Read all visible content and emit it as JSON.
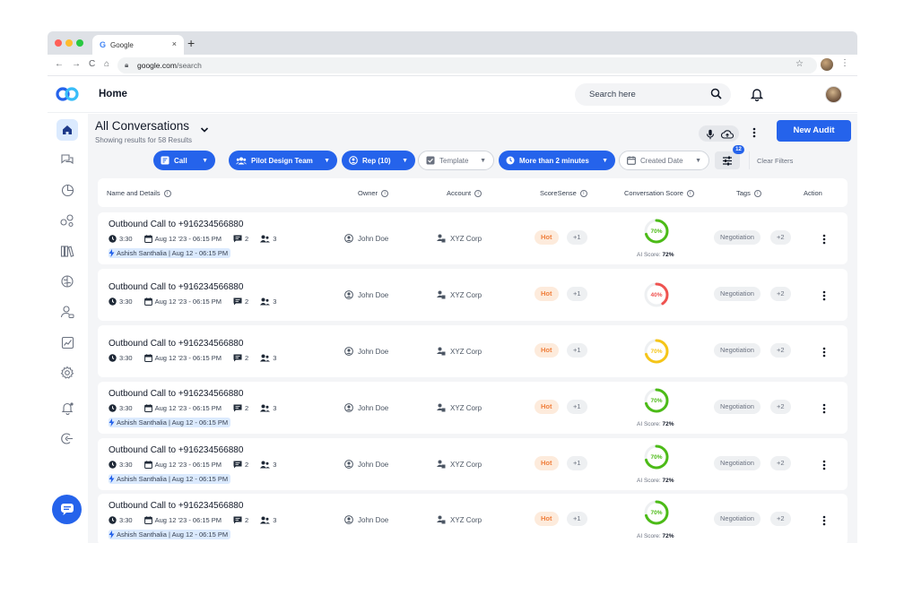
{
  "browser": {
    "tab_title": "Google",
    "tab_icon": "G",
    "tab_close": "×",
    "new_tab": "+",
    "url_host": "google.com",
    "url_path": "/search"
  },
  "header": {
    "title": "Home",
    "search_placeholder": "Search here"
  },
  "page": {
    "title": "All Conversations",
    "subtitle": "Showing results for 58 Results",
    "new_audit_label": "New Audit"
  },
  "filters": {
    "call": "Call",
    "team": "Pilot Design Team",
    "rep": "Rep (10)",
    "template": "Template",
    "duration": "More than 2 minutes",
    "created_date": "Created Date",
    "filter_count": "12",
    "clear": "Clear Filters"
  },
  "table": {
    "headers": {
      "name": "Name and Details",
      "owner": "Owner",
      "account": "Account",
      "scoresense": "ScoreSense",
      "score": "Conversation Score",
      "tags": "Tags",
      "action": "Action"
    },
    "rows": [
      {
        "title": "Outbound Call to +916234566880",
        "duration": "3:30",
        "date": "Aug 12 '23 - 06:15 PM",
        "comments": "2",
        "participants": "3",
        "agent": "Ashish Santhalia | Aug 12 - 06:15 PM",
        "owner": "John Doe",
        "account": "XYZ Corp",
        "score_tag": "Hot",
        "score_more": "+1",
        "score": 70,
        "score_label": "70%",
        "score_color": "#4cbb17",
        "ai_label": "AI Score:",
        "ai_score": "72%",
        "tag": "Negotiation",
        "tag_more": "+2"
      },
      {
        "title": "Outbound Call to +916234566880",
        "duration": "3:30",
        "date": "Aug 12 '23 - 06:15 PM",
        "comments": "2",
        "participants": "3",
        "owner": "John Doe",
        "account": "XYZ Corp",
        "score_tag": "Hot",
        "score_more": "+1",
        "score": 40,
        "score_label": "40%",
        "score_color": "#ef5350",
        "tag": "Negotiation",
        "tag_more": "+2"
      },
      {
        "title": "Outbound Call to +916234566880",
        "duration": "3:30",
        "date": "Aug 12 '23 - 06:15 PM",
        "comments": "2",
        "participants": "3",
        "owner": "John Doe",
        "account": "XYZ Corp",
        "score_tag": "Hot",
        "score_more": "+1",
        "score": 70,
        "score_label": "70%",
        "score_color": "#f5c518",
        "tag": "Negotiation",
        "tag_more": "+2"
      },
      {
        "title": "Outbound Call to +916234566880",
        "duration": "3:30",
        "date": "Aug 12 '23 - 06:15 PM",
        "comments": "2",
        "participants": "3",
        "agent": "Ashish Santhalia | Aug 12 - 06:15 PM",
        "owner": "John Doe",
        "account": "XYZ Corp",
        "score_tag": "Hot",
        "score_more": "+1",
        "score": 70,
        "score_label": "70%",
        "score_color": "#4cbb17",
        "ai_label": "AI Score:",
        "ai_score": "72%",
        "tag": "Negotiation",
        "tag_more": "+2"
      },
      {
        "title": "Outbound Call to +916234566880",
        "duration": "3:30",
        "date": "Aug 12 '23 - 06:15 PM",
        "comments": "2",
        "participants": "3",
        "agent": "Ashish Santhalia | Aug 12 - 06:15 PM",
        "owner": "John Doe",
        "account": "XYZ Corp",
        "score_tag": "Hot",
        "score_more": "+1",
        "score": 70,
        "score_label": "70%",
        "score_color": "#4cbb17",
        "ai_label": "AI Score:",
        "ai_score": "72%",
        "tag": "Negotiation",
        "tag_more": "+2"
      },
      {
        "title": "Outbound Call to +916234566880",
        "duration": "3:30",
        "date": "Aug 12 '23 - 06:15 PM",
        "comments": "2",
        "participants": "3",
        "agent": "Ashish Santhalia | Aug 12 - 06:15 PM",
        "owner": "John Doe",
        "account": "XYZ Corp",
        "score_tag": "Hot",
        "score_more": "+1",
        "score": 70,
        "score_label": "70%",
        "score_color": "#4cbb17",
        "ai_label": "AI Score:",
        "ai_score": "72%",
        "tag": "Negotiation",
        "tag_more": "+2"
      }
    ]
  },
  "colors": {
    "accent": "#2563eb",
    "hot_bg": "#fdebdc",
    "hot_text": "#f07f3c"
  },
  "sidebar_icons": [
    "home-icon",
    "conversations-icon",
    "analytics-icon",
    "nodes-icon",
    "library-icon",
    "brain-icon",
    "team-icon",
    "trend-icon",
    "settings-icon",
    "alerts-icon",
    "logout-icon",
    "chat-icon"
  ]
}
